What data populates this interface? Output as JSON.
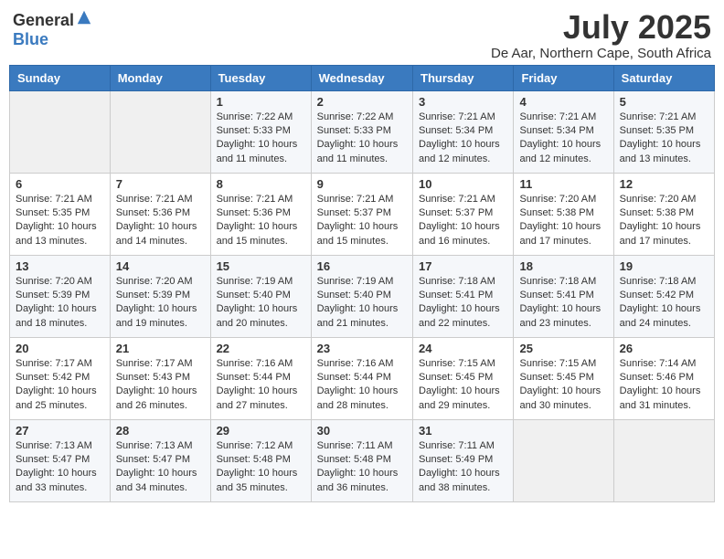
{
  "header": {
    "logo_general": "General",
    "logo_blue": "Blue",
    "month_year": "July 2025",
    "location": "De Aar, Northern Cape, South Africa"
  },
  "days_of_week": [
    "Sunday",
    "Monday",
    "Tuesday",
    "Wednesday",
    "Thursday",
    "Friday",
    "Saturday"
  ],
  "weeks": [
    [
      {
        "day": "",
        "sunrise": "",
        "sunset": "",
        "daylight": ""
      },
      {
        "day": "",
        "sunrise": "",
        "sunset": "",
        "daylight": ""
      },
      {
        "day": "1",
        "sunrise": "Sunrise: 7:22 AM",
        "sunset": "Sunset: 5:33 PM",
        "daylight": "Daylight: 10 hours and 11 minutes."
      },
      {
        "day": "2",
        "sunrise": "Sunrise: 7:22 AM",
        "sunset": "Sunset: 5:33 PM",
        "daylight": "Daylight: 10 hours and 11 minutes."
      },
      {
        "day": "3",
        "sunrise": "Sunrise: 7:21 AM",
        "sunset": "Sunset: 5:34 PM",
        "daylight": "Daylight: 10 hours and 12 minutes."
      },
      {
        "day": "4",
        "sunrise": "Sunrise: 7:21 AM",
        "sunset": "Sunset: 5:34 PM",
        "daylight": "Daylight: 10 hours and 12 minutes."
      },
      {
        "day": "5",
        "sunrise": "Sunrise: 7:21 AM",
        "sunset": "Sunset: 5:35 PM",
        "daylight": "Daylight: 10 hours and 13 minutes."
      }
    ],
    [
      {
        "day": "6",
        "sunrise": "Sunrise: 7:21 AM",
        "sunset": "Sunset: 5:35 PM",
        "daylight": "Daylight: 10 hours and 13 minutes."
      },
      {
        "day": "7",
        "sunrise": "Sunrise: 7:21 AM",
        "sunset": "Sunset: 5:36 PM",
        "daylight": "Daylight: 10 hours and 14 minutes."
      },
      {
        "day": "8",
        "sunrise": "Sunrise: 7:21 AM",
        "sunset": "Sunset: 5:36 PM",
        "daylight": "Daylight: 10 hours and 15 minutes."
      },
      {
        "day": "9",
        "sunrise": "Sunrise: 7:21 AM",
        "sunset": "Sunset: 5:37 PM",
        "daylight": "Daylight: 10 hours and 15 minutes."
      },
      {
        "day": "10",
        "sunrise": "Sunrise: 7:21 AM",
        "sunset": "Sunset: 5:37 PM",
        "daylight": "Daylight: 10 hours and 16 minutes."
      },
      {
        "day": "11",
        "sunrise": "Sunrise: 7:20 AM",
        "sunset": "Sunset: 5:38 PM",
        "daylight": "Daylight: 10 hours and 17 minutes."
      },
      {
        "day": "12",
        "sunrise": "Sunrise: 7:20 AM",
        "sunset": "Sunset: 5:38 PM",
        "daylight": "Daylight: 10 hours and 17 minutes."
      }
    ],
    [
      {
        "day": "13",
        "sunrise": "Sunrise: 7:20 AM",
        "sunset": "Sunset: 5:39 PM",
        "daylight": "Daylight: 10 hours and 18 minutes."
      },
      {
        "day": "14",
        "sunrise": "Sunrise: 7:20 AM",
        "sunset": "Sunset: 5:39 PM",
        "daylight": "Daylight: 10 hours and 19 minutes."
      },
      {
        "day": "15",
        "sunrise": "Sunrise: 7:19 AM",
        "sunset": "Sunset: 5:40 PM",
        "daylight": "Daylight: 10 hours and 20 minutes."
      },
      {
        "day": "16",
        "sunrise": "Sunrise: 7:19 AM",
        "sunset": "Sunset: 5:40 PM",
        "daylight": "Daylight: 10 hours and 21 minutes."
      },
      {
        "day": "17",
        "sunrise": "Sunrise: 7:18 AM",
        "sunset": "Sunset: 5:41 PM",
        "daylight": "Daylight: 10 hours and 22 minutes."
      },
      {
        "day": "18",
        "sunrise": "Sunrise: 7:18 AM",
        "sunset": "Sunset: 5:41 PM",
        "daylight": "Daylight: 10 hours and 23 minutes."
      },
      {
        "day": "19",
        "sunrise": "Sunrise: 7:18 AM",
        "sunset": "Sunset: 5:42 PM",
        "daylight": "Daylight: 10 hours and 24 minutes."
      }
    ],
    [
      {
        "day": "20",
        "sunrise": "Sunrise: 7:17 AM",
        "sunset": "Sunset: 5:42 PM",
        "daylight": "Daylight: 10 hours and 25 minutes."
      },
      {
        "day": "21",
        "sunrise": "Sunrise: 7:17 AM",
        "sunset": "Sunset: 5:43 PM",
        "daylight": "Daylight: 10 hours and 26 minutes."
      },
      {
        "day": "22",
        "sunrise": "Sunrise: 7:16 AM",
        "sunset": "Sunset: 5:44 PM",
        "daylight": "Daylight: 10 hours and 27 minutes."
      },
      {
        "day": "23",
        "sunrise": "Sunrise: 7:16 AM",
        "sunset": "Sunset: 5:44 PM",
        "daylight": "Daylight: 10 hours and 28 minutes."
      },
      {
        "day": "24",
        "sunrise": "Sunrise: 7:15 AM",
        "sunset": "Sunset: 5:45 PM",
        "daylight": "Daylight: 10 hours and 29 minutes."
      },
      {
        "day": "25",
        "sunrise": "Sunrise: 7:15 AM",
        "sunset": "Sunset: 5:45 PM",
        "daylight": "Daylight: 10 hours and 30 minutes."
      },
      {
        "day": "26",
        "sunrise": "Sunrise: 7:14 AM",
        "sunset": "Sunset: 5:46 PM",
        "daylight": "Daylight: 10 hours and 31 minutes."
      }
    ],
    [
      {
        "day": "27",
        "sunrise": "Sunrise: 7:13 AM",
        "sunset": "Sunset: 5:47 PM",
        "daylight": "Daylight: 10 hours and 33 minutes."
      },
      {
        "day": "28",
        "sunrise": "Sunrise: 7:13 AM",
        "sunset": "Sunset: 5:47 PM",
        "daylight": "Daylight: 10 hours and 34 minutes."
      },
      {
        "day": "29",
        "sunrise": "Sunrise: 7:12 AM",
        "sunset": "Sunset: 5:48 PM",
        "daylight": "Daylight: 10 hours and 35 minutes."
      },
      {
        "day": "30",
        "sunrise": "Sunrise: 7:11 AM",
        "sunset": "Sunset: 5:48 PM",
        "daylight": "Daylight: 10 hours and 36 minutes."
      },
      {
        "day": "31",
        "sunrise": "Sunrise: 7:11 AM",
        "sunset": "Sunset: 5:49 PM",
        "daylight": "Daylight: 10 hours and 38 minutes."
      },
      {
        "day": "",
        "sunrise": "",
        "sunset": "",
        "daylight": ""
      },
      {
        "day": "",
        "sunrise": "",
        "sunset": "",
        "daylight": ""
      }
    ]
  ]
}
